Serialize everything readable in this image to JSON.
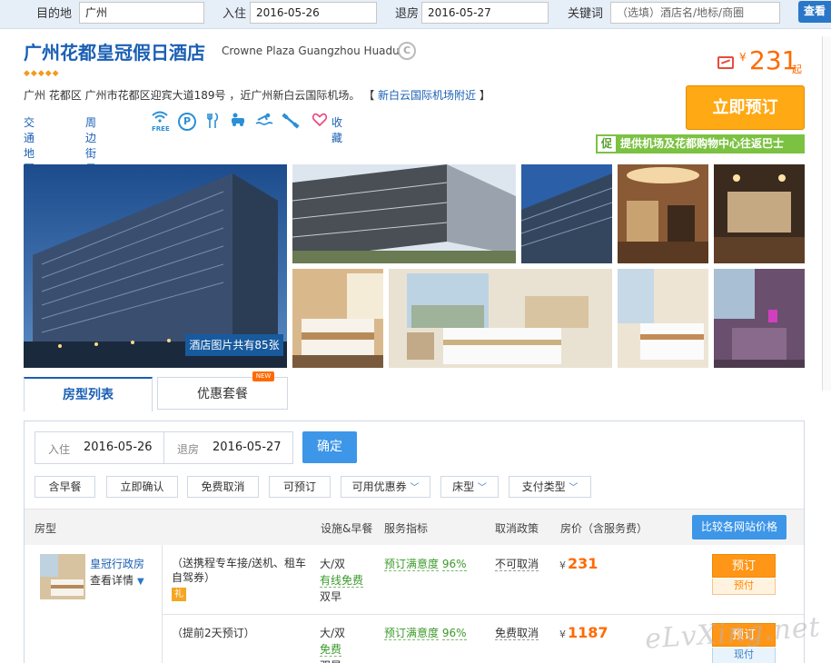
{
  "search": {
    "dest_label": "目的地",
    "dest_value": "广州",
    "checkin_label": "入住",
    "checkin_value": "2016-05-26",
    "checkout_label": "退房",
    "checkout_value": "2016-05-27",
    "keyword_label": "关键词",
    "keyword_placeholder": "（选填）酒店名/地标/商圈",
    "search_button": "查看"
  },
  "hotel": {
    "name": "广州花都皇冠假日酒店",
    "name_en": "Crowne Plaza Guangzhou Huadu",
    "brand_badge": "C",
    "rating_diamonds": 5,
    "address": "广州 花都区 广州市花都区迎宾大道189号 ，近广州新白云国际机场。",
    "zone_open": "【",
    "zone": "新白云国际机场附近",
    "zone_close": "】",
    "link_map": "交通地图",
    "link_street": "周边街景",
    "amenity_free": "FREE",
    "amenity_parking": "P",
    "favorite": "收藏"
  },
  "price": {
    "currency": "¥",
    "amount": "231",
    "suffix": "起"
  },
  "book_now": "立即预订",
  "promo": {
    "tag": "促",
    "text": "提供机场及花都购物中心往返巴士"
  },
  "gallery": {
    "count_text": "酒店图片共有85张"
  },
  "tabs": {
    "rooms": "房型列表",
    "packages": "优惠套餐",
    "new_badge": "NEW"
  },
  "date_filter": {
    "checkin_label": "入住",
    "checkin_value": "2016-05-26",
    "checkout_label": "退房",
    "checkout_value": "2016-05-27",
    "confirm": "确定"
  },
  "filters": [
    "含早餐",
    "立即确认",
    "免费取消",
    "可预订",
    "可用优惠券",
    "床型",
    "支付类型"
  ],
  "table": {
    "col_room": "房型",
    "col_facility": "设施&早餐",
    "col_service": "服务指标",
    "col_cancel": "取消政策",
    "col_price": "房价（含服务费）",
    "compare_btn": "比较各网站价格"
  },
  "room": {
    "name": "皇冠行政房",
    "detail": "查看详情"
  },
  "rates": [
    {
      "desc": "（送携程专车接/送机、租车自驾券）",
      "gift": "礼",
      "bed": "大/双",
      "wifi": "有线免费",
      "breakfast": "双早",
      "satisfaction_label": "预订满意度",
      "satisfaction": "96%",
      "cancel": "不可取消",
      "currency": "¥",
      "price": "231",
      "book": "预订",
      "pay": "预付"
    },
    {
      "desc": "（提前2天预订）",
      "bed": "大/双",
      "wifi": "免费",
      "breakfast": "双早",
      "satisfaction_label": "预订满意度",
      "satisfaction": "96%",
      "cancel": "免费取消",
      "currency": "¥",
      "price": "1187",
      "book": "预订",
      "pay": "现付"
    }
  ],
  "watermark": "eLvXing.net",
  "colors": {
    "link_blue": "#1a5fb4",
    "price_orange": "#ff6a00",
    "book_orange": "#ffa914",
    "promo_green": "#7cc242",
    "button_blue": "#3d96e8"
  }
}
